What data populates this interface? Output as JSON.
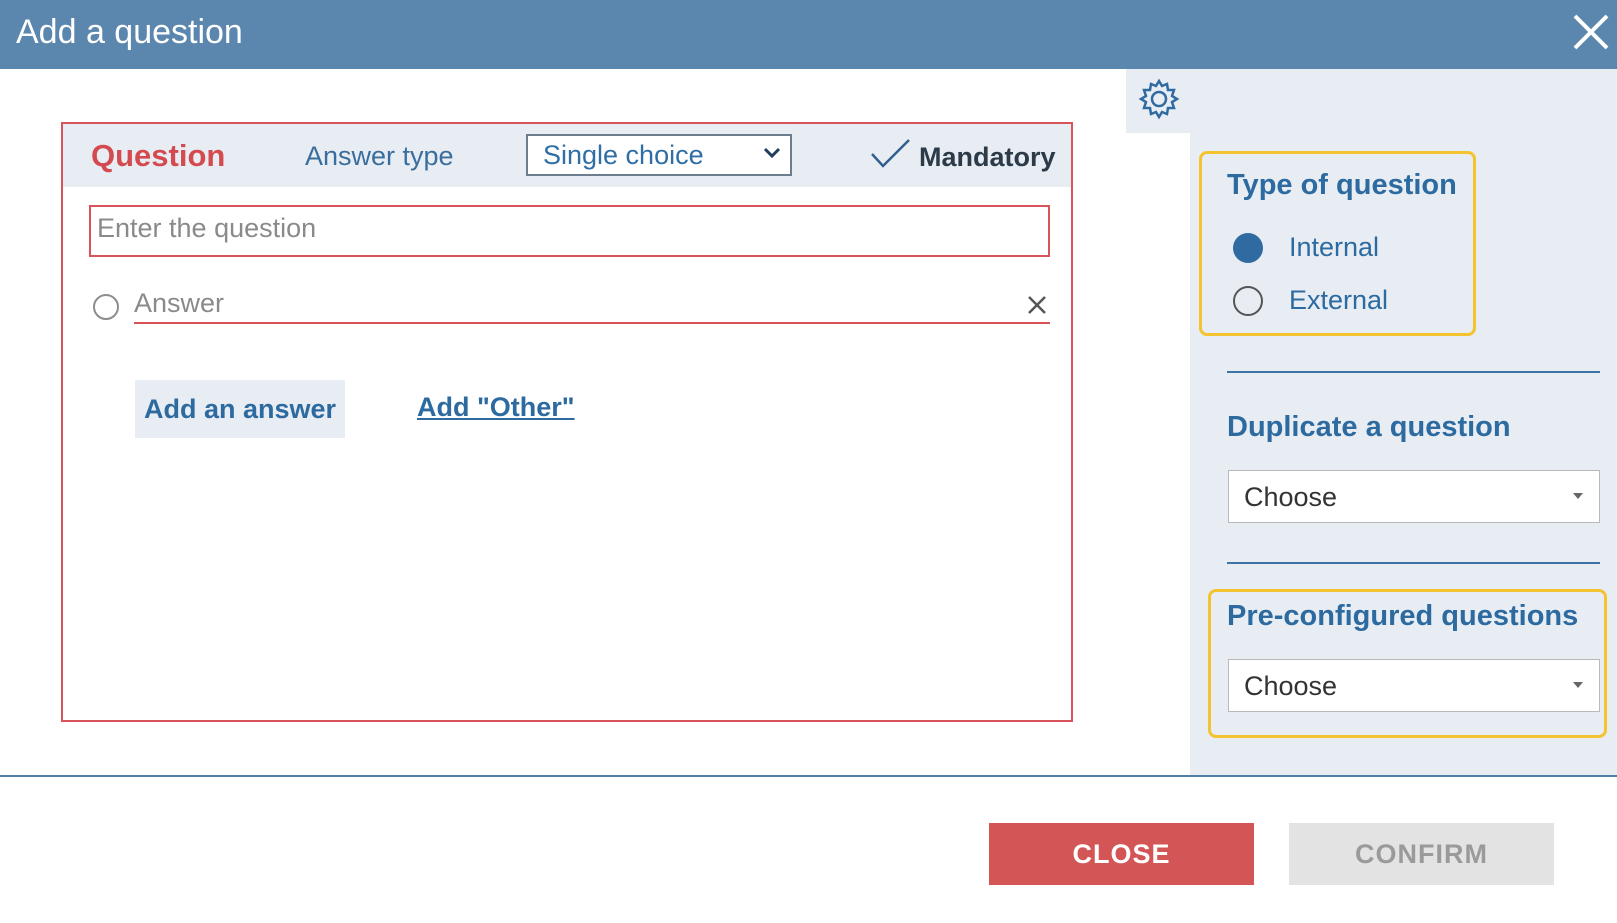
{
  "dialog": {
    "title": "Add a question"
  },
  "question_panel": {
    "heading": "Question",
    "answer_type_label": "Answer type",
    "answer_type_value": "Single choice",
    "mandatory_label": "Mandatory",
    "question_placeholder": "Enter the question",
    "answer_placeholder": "Answer",
    "add_answer_label": "Add an answer",
    "add_other_label": "Add \"Other\""
  },
  "sidebar": {
    "type_title": "Type of question",
    "type_options": [
      {
        "label": "Internal",
        "selected": true
      },
      {
        "label": "External",
        "selected": false
      }
    ],
    "duplicate_title": "Duplicate a question",
    "duplicate_value": "Choose",
    "preconfigured_title": "Pre-configured questions",
    "preconfigured_value": "Choose"
  },
  "footer": {
    "close_label": "CLOSE",
    "confirm_label": "CONFIRM"
  },
  "colors": {
    "titlebar": "#5b86ad",
    "accent_blue": "#2c6aa0",
    "error_red": "#d9535a",
    "highlight_yellow": "#f3c430",
    "panel_bg": "#e8edf4"
  }
}
